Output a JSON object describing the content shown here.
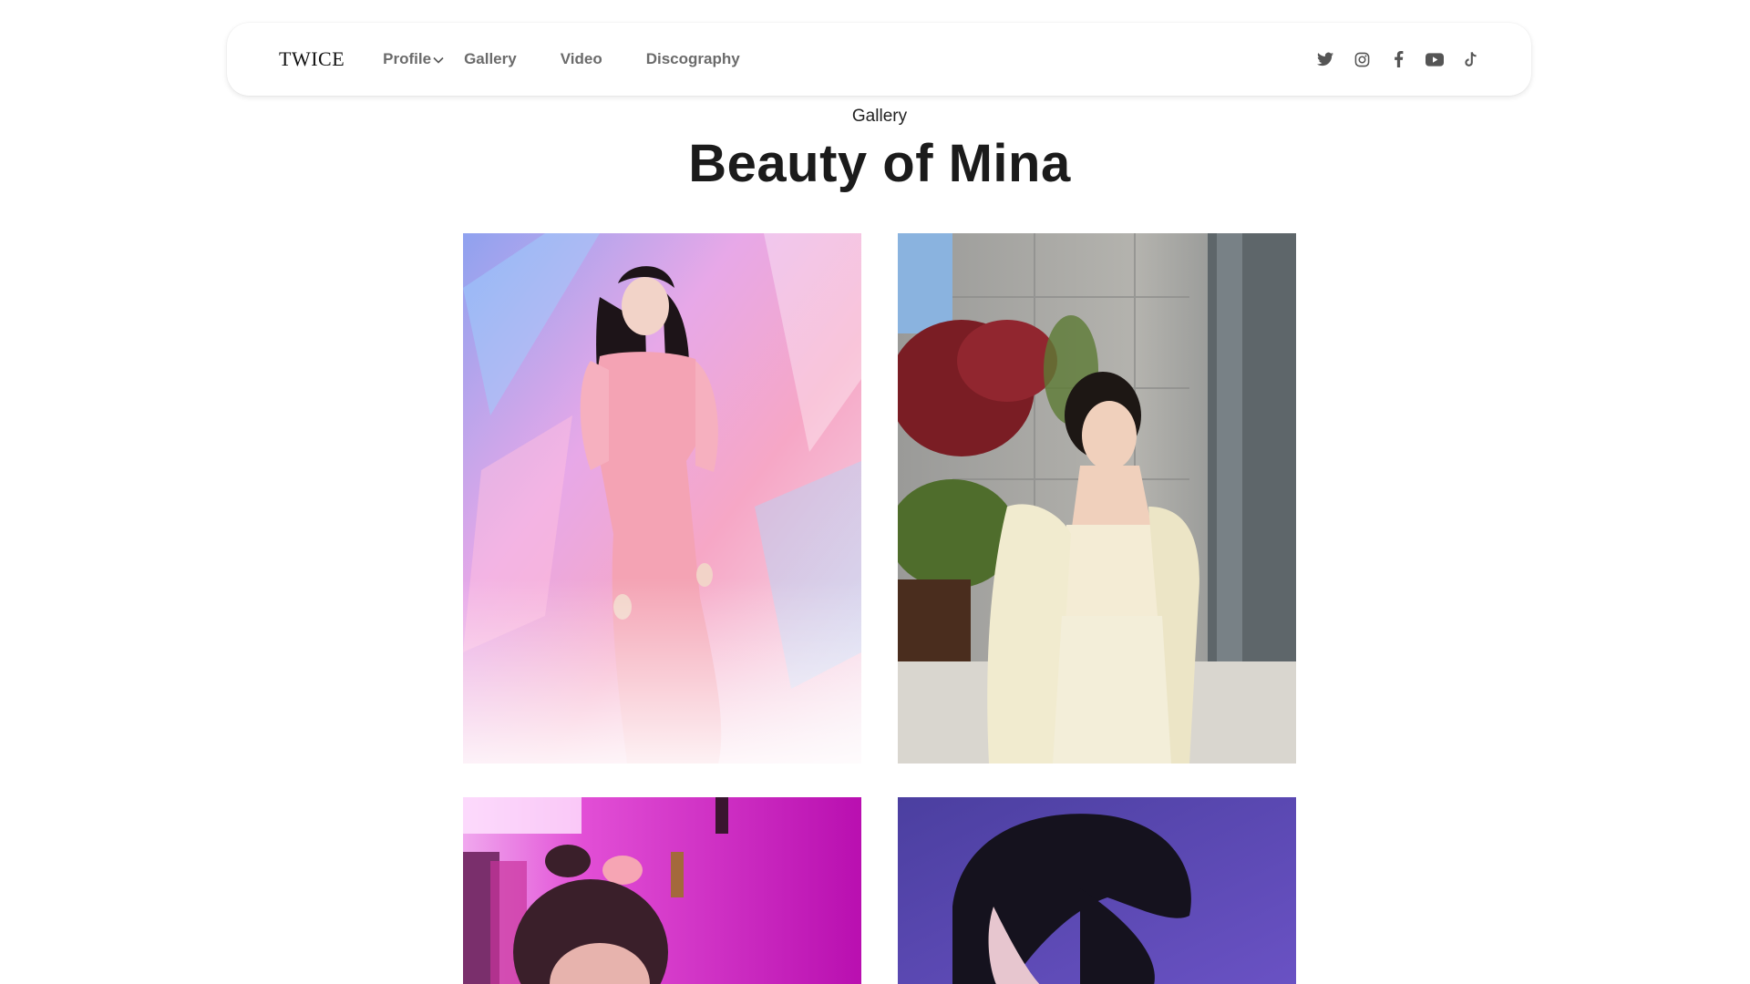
{
  "nav": {
    "logo": "TWICE",
    "links": [
      {
        "label": "Profile",
        "has_dropdown": true
      },
      {
        "label": "Gallery"
      },
      {
        "label": "Video"
      },
      {
        "label": "Discography"
      }
    ],
    "social_icons": [
      "twitter-icon",
      "instagram-icon",
      "facebook-icon",
      "youtube-icon",
      "tiktok-icon"
    ]
  },
  "header": {
    "kicker": "Gallery",
    "title": "Beauty of Mina"
  },
  "gallery": {
    "photos": [
      {
        "name": "photo-pink-dress",
        "tone": "#f4a8c4"
      },
      {
        "name": "photo-cream-jacket",
        "tone": "#e9e3cf"
      },
      {
        "name": "photo-magenta-room",
        "tone": "#c21fb6"
      },
      {
        "name": "photo-purple-backdrop",
        "tone": "#5a3fa8"
      }
    ]
  },
  "colors": {
    "nav_text": "#6b6b6b",
    "icon": "#555555",
    "title": "#1b1b1b"
  }
}
